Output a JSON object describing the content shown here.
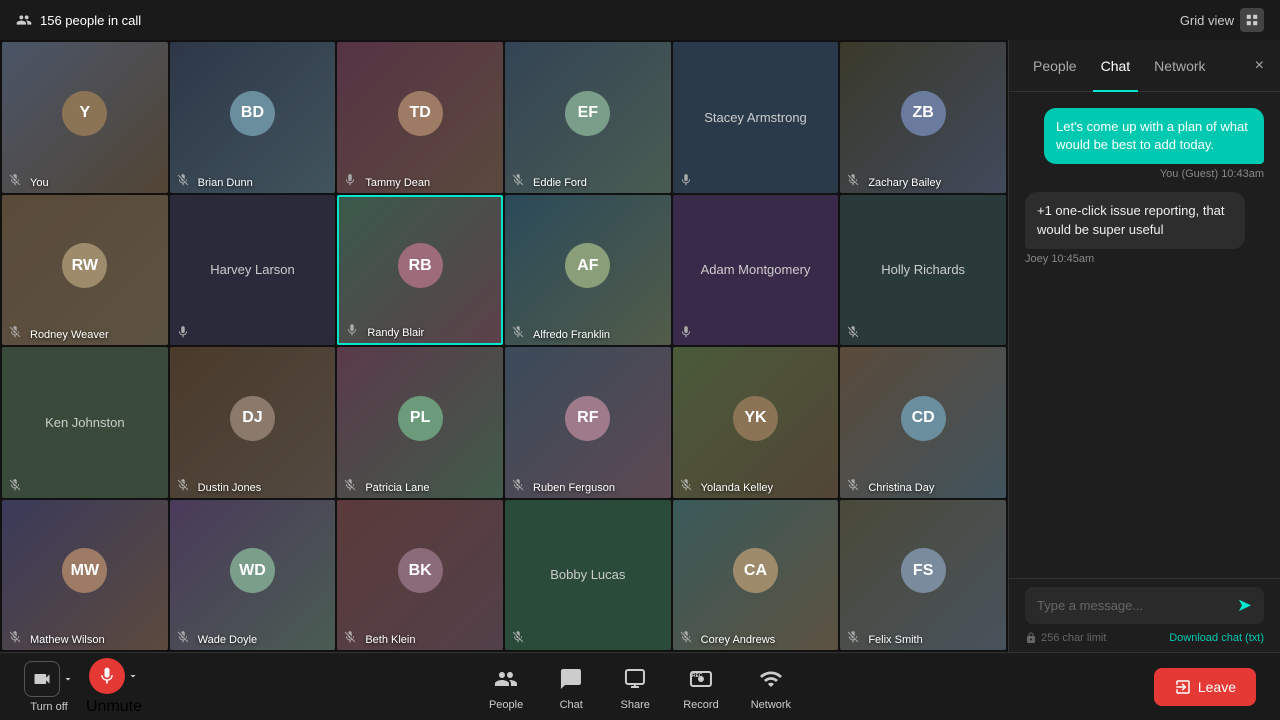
{
  "topBar": {
    "peopleCount": "156 people in call",
    "gridViewLabel": "Grid view"
  },
  "videoGrid": {
    "cells": [
      {
        "id": "you",
        "name": "You",
        "hasVideo": true,
        "bgColor": "#4a5568",
        "micOff": true,
        "speaking": false
      },
      {
        "id": "brian-dunn",
        "name": "Brian Dunn",
        "hasVideo": true,
        "bgColor": "#2d3748",
        "micOff": true,
        "speaking": false
      },
      {
        "id": "tammy-dean",
        "name": "Tammy Dean",
        "hasVideo": true,
        "bgColor": "#553344",
        "micOff": false,
        "speaking": false
      },
      {
        "id": "eddie-ford",
        "name": "Eddie Ford",
        "hasVideo": true,
        "bgColor": "#334455",
        "micOff": true,
        "speaking": false
      },
      {
        "id": "stacey-armstrong",
        "name": "Stacey Armstrong",
        "hasVideo": false,
        "bgColor": "#2a3a4a",
        "micOff": false,
        "speaking": false
      },
      {
        "id": "zachary-bailey",
        "name": "Zachary Bailey",
        "hasVideo": true,
        "bgColor": "#3a3a2a",
        "micOff": true,
        "speaking": false
      },
      {
        "id": "rodney-weaver",
        "name": "Rodney Weaver",
        "hasVideo": true,
        "bgColor": "#5a4a3a",
        "micOff": true,
        "speaking": false
      },
      {
        "id": "harvey-larson",
        "name": "Harvey Larson",
        "hasVideo": false,
        "bgColor": "#2a2a3a",
        "micOff": false,
        "speaking": false
      },
      {
        "id": "randy-blair",
        "name": "Randy Blair",
        "hasVideo": true,
        "bgColor": "#3a5a4a",
        "micOff": false,
        "speaking": true
      },
      {
        "id": "alfredo-franklin",
        "name": "Alfredo Franklin",
        "hasVideo": true,
        "bgColor": "#2a4a5a",
        "micOff": true,
        "speaking": false
      },
      {
        "id": "adam-montgomery",
        "name": "Adam Montgomery",
        "hasVideo": false,
        "bgColor": "#3a2a4a",
        "micOff": false,
        "speaking": false
      },
      {
        "id": "holly-richards",
        "name": "Holly Richards",
        "hasVideo": false,
        "bgColor": "#2a3a3a",
        "micOff": true,
        "speaking": false
      },
      {
        "id": "ken-johnston",
        "name": "Ken Johnston",
        "hasVideo": false,
        "bgColor": "#3a4a3a",
        "micOff": true,
        "speaking": false
      },
      {
        "id": "dustin-jones",
        "name": "Dustin Jones",
        "hasVideo": true,
        "bgColor": "#4a3a2a",
        "micOff": true,
        "speaking": false
      },
      {
        "id": "patricia-lane",
        "name": "Patricia Lane",
        "hasVideo": true,
        "bgColor": "#5a3a4a",
        "micOff": true,
        "speaking": false
      },
      {
        "id": "ruben-ferguson",
        "name": "Ruben Ferguson",
        "hasVideo": true,
        "bgColor": "#3a4a5a",
        "micOff": true,
        "speaking": false
      },
      {
        "id": "yolanda-kelley",
        "name": "Yolanda Kelley",
        "hasVideo": true,
        "bgColor": "#4a5a3a",
        "micOff": true,
        "speaking": false
      },
      {
        "id": "christina-day",
        "name": "Christina Day",
        "hasVideo": true,
        "bgColor": "#5a4a3a",
        "micOff": true,
        "speaking": false
      },
      {
        "id": "mathew-wilson",
        "name": "Mathew Wilson",
        "hasVideo": true,
        "bgColor": "#3a3a5a",
        "micOff": true,
        "speaking": false
      },
      {
        "id": "wade-doyle",
        "name": "Wade Doyle",
        "hasVideo": true,
        "bgColor": "#4a3a5a",
        "micOff": true,
        "speaking": false
      },
      {
        "id": "beth-klein",
        "name": "Beth Klein",
        "hasVideo": true,
        "bgColor": "#5a3a3a",
        "micOff": true,
        "speaking": false
      },
      {
        "id": "bobby-lucas",
        "name": "Bobby Lucas",
        "hasVideo": false,
        "bgColor": "#2a4a3a",
        "micOff": true,
        "speaking": false
      },
      {
        "id": "corey-andrews",
        "name": "Corey Andrews",
        "hasVideo": true,
        "bgColor": "#3a5a5a",
        "micOff": true,
        "speaking": false
      },
      {
        "id": "felix-smith",
        "name": "Felix Smith",
        "hasVideo": true,
        "bgColor": "#4a4a3a",
        "micOff": true,
        "speaking": false
      }
    ]
  },
  "rightPanel": {
    "tabs": [
      "People",
      "Chat",
      "Network"
    ],
    "activeTab": "Chat",
    "closeLabel": "×",
    "messages": [
      {
        "id": "msg1",
        "text": "Let's come up with a plan of what would be best to add today.",
        "sender": "You (Guest)",
        "time": "10:43am",
        "own": true
      },
      {
        "id": "msg2",
        "text": "+1 one-click issue reporting, that would be super useful",
        "sender": "Joey",
        "time": "10:45am",
        "own": false
      }
    ],
    "inputPlaceholder": "Type a message...",
    "charLimit": "256 char limit",
    "downloadChat": "Download chat (txt)",
    "sendIcon": "➤"
  },
  "bottomBar": {
    "turnOffLabel": "Turn off",
    "unmuteLabel": "Unmute",
    "peopleLabel": "People",
    "chatLabel": "Chat",
    "shareLabel": "Share",
    "recordLabel": "Record",
    "networkLabel": "Network",
    "leaveLabel": "Leave"
  }
}
